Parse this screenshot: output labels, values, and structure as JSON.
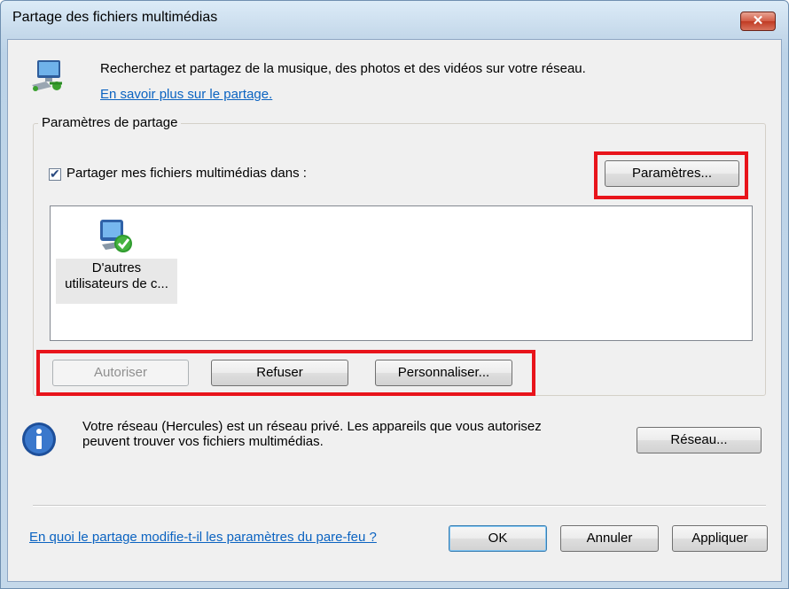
{
  "window": {
    "title": "Partage des fichiers multimédias",
    "close_label": "✕"
  },
  "header": {
    "description": "Recherchez et partagez de la musique, des photos et des vidéos sur votre réseau.",
    "learn_more_link": "En savoir plus sur le partage."
  },
  "sharing_settings": {
    "group_label": "Paramètres de partage",
    "share_checkbox_label": "Partager mes fichiers multimédias dans :",
    "share_checked": true,
    "settings_button": "Paramètres...",
    "devices": [
      {
        "label_line1": "D'autres",
        "label_line2": "utilisateurs de c...",
        "icon": "network-computer-check-icon"
      }
    ],
    "allow_button": "Autoriser",
    "deny_button": "Refuser",
    "customize_button": "Personnaliser..."
  },
  "network_info": {
    "line1": "Votre réseau (Hercules) est un réseau privé. Les appareils que vous autorisez",
    "line2": "peuvent trouver vos fichiers multimédias.",
    "network_button": "Réseau..."
  },
  "footer": {
    "firewall_link": "En quoi le partage modifie-t-il les paramètres du pare-feu ?",
    "ok_button": "OK",
    "cancel_button": "Annuler",
    "apply_button": "Appliquer"
  },
  "colors": {
    "highlight": "#e8141b",
    "link": "#0b63c1",
    "close_button": "#c03a23"
  }
}
